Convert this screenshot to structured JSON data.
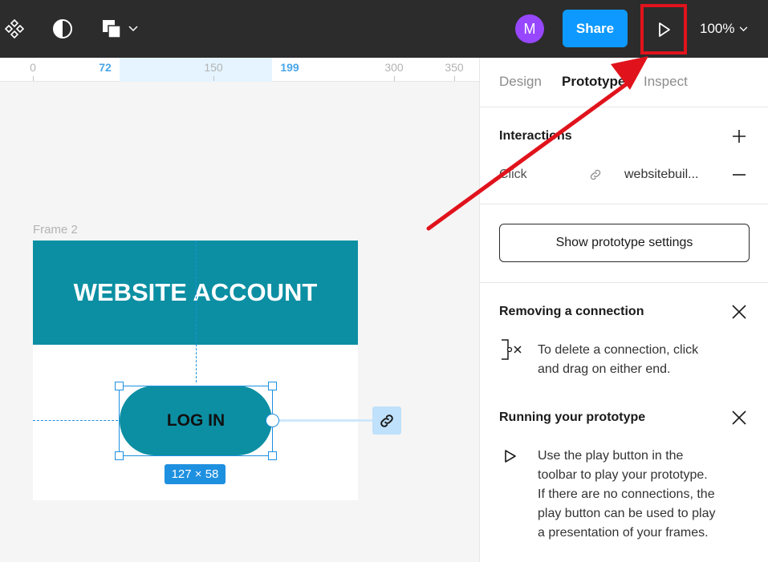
{
  "toolbar": {
    "avatar_initial": "M",
    "share_label": "Share",
    "zoom_label": "100%"
  },
  "ruler": {
    "ticks": [
      "0",
      "72",
      "150",
      "199",
      "300",
      "350"
    ]
  },
  "canvas": {
    "frame_label": "Frame 2",
    "header_text": "WEBSITE ACCOUNT",
    "button_text": "LOG IN",
    "size_badge": "127 × 58"
  },
  "panel": {
    "tabs": [
      "Design",
      "Prototype",
      "Inspect"
    ],
    "interactions_title": "Interactions",
    "interaction": {
      "trigger": "Click",
      "destination": "websitebuil..."
    },
    "settings_button": "Show prototype settings",
    "removing": {
      "title": "Removing a connection",
      "lines": [
        "To delete a connection, click",
        "and drag on either end."
      ]
    },
    "running": {
      "title": "Running your prototype",
      "lines": [
        "Use the play button in the",
        "toolbar to play your prototype.",
        "If there are no connections, the",
        "play button can be used to play",
        "a presentation of your frames."
      ]
    }
  },
  "colors": {
    "toolbar_bg": "#2c2c2c",
    "accent": "#0d99ff",
    "frame_teal": "#0c8fa3",
    "avatar": "#9747ff",
    "annotation_red": "#e0131c"
  },
  "icons": [
    "components-icon",
    "contrast-icon",
    "shapes-icon",
    "chevron-down-icon",
    "play-icon",
    "plus-icon",
    "link-icon",
    "minus-icon",
    "close-icon",
    "disconnect-icon"
  ]
}
